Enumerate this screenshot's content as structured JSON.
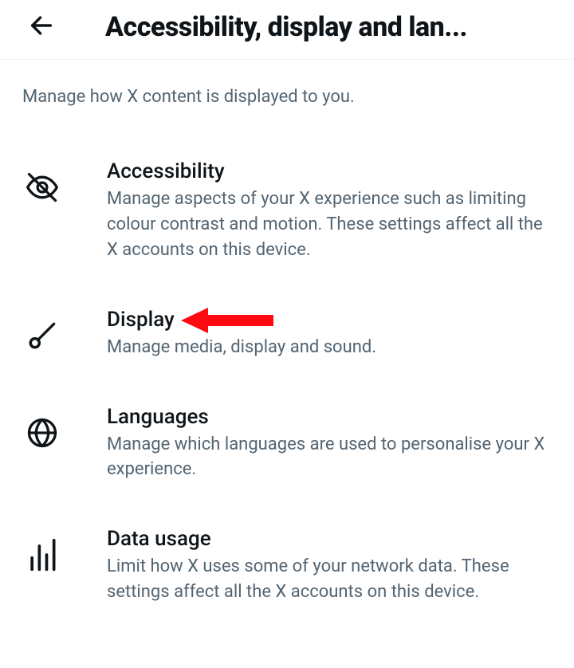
{
  "header": {
    "title": "Accessibility, display and lan..."
  },
  "subtitle": "Manage how X content is displayed to you.",
  "items": [
    {
      "icon": "eye-off-icon",
      "title": "Accessibility",
      "desc": "Manage aspects of your X experience such as limiting colour contrast and motion. These settings affect all the X accounts on this device."
    },
    {
      "icon": "brush-icon",
      "title": "Display",
      "desc": "Manage media, display and sound."
    },
    {
      "icon": "globe-icon",
      "title": "Languages",
      "desc": "Manage which languages are used to personalise your X experience."
    },
    {
      "icon": "bars-icon",
      "title": "Data usage",
      "desc": "Limit how X uses some of your network data. These settings affect all the X accounts on this device."
    }
  ],
  "annotation": {
    "target_index": 1,
    "type": "arrow",
    "color": "#ff0a12"
  }
}
